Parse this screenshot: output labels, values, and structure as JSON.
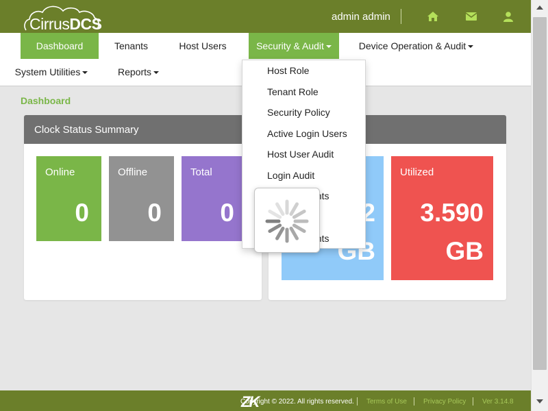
{
  "app": {
    "logo_text_light": "Cirrus",
    "logo_text_bold": "DCS",
    "user_name": "admin admin",
    "icons": [
      "home-icon",
      "mail-icon",
      "user-icon"
    ]
  },
  "nav": {
    "items": [
      {
        "label": "Dashboard",
        "active": true
      },
      {
        "label": "Tenants"
      },
      {
        "label": "Host Users"
      },
      {
        "label": "Security & Audit",
        "active": true,
        "dropdown": true
      },
      {
        "label": "Device Operation & Audit",
        "dropdown": true
      },
      {
        "label": "System Utilities",
        "dropdown": true
      },
      {
        "label": "Reports",
        "dropdown": true
      }
    ]
  },
  "breadcrumb": "Dashboard",
  "clock_panel": {
    "title": "Clock Status Summary",
    "tiles": [
      {
        "label": "Online",
        "value": "0",
        "color": "#7ab648"
      },
      {
        "label": "Offline",
        "value": "0",
        "color": "#929292"
      },
      {
        "label": "Total",
        "value": "0",
        "color": "#9575cd"
      }
    ]
  },
  "storage_panel": {
    "tiles": [
      {
        "label": "",
        "value_line1": "2",
        "value_line2": "GB",
        "color": "#90caf9"
      },
      {
        "label": "Utilized",
        "value_line1": "3.590",
        "value_line2": "GB",
        "color": "#ef5350"
      }
    ]
  },
  "dropdown": {
    "items": [
      "Host Role",
      "Tenant Role",
      "Security Policy",
      "Active Login Users",
      "Host User Audit",
      "Login Audit",
      "unts",
      "unts"
    ]
  },
  "footer": {
    "brand": "ZK",
    "copyright": "Copyright © 2022. All rights reserved.",
    "terms": "Terms of Use",
    "privacy": "Privacy Policy",
    "version": "Ver 3.14.8"
  },
  "colors": {
    "header": "#6b7f2a",
    "accent": "#7ab648",
    "icon": "#b4e05a"
  }
}
